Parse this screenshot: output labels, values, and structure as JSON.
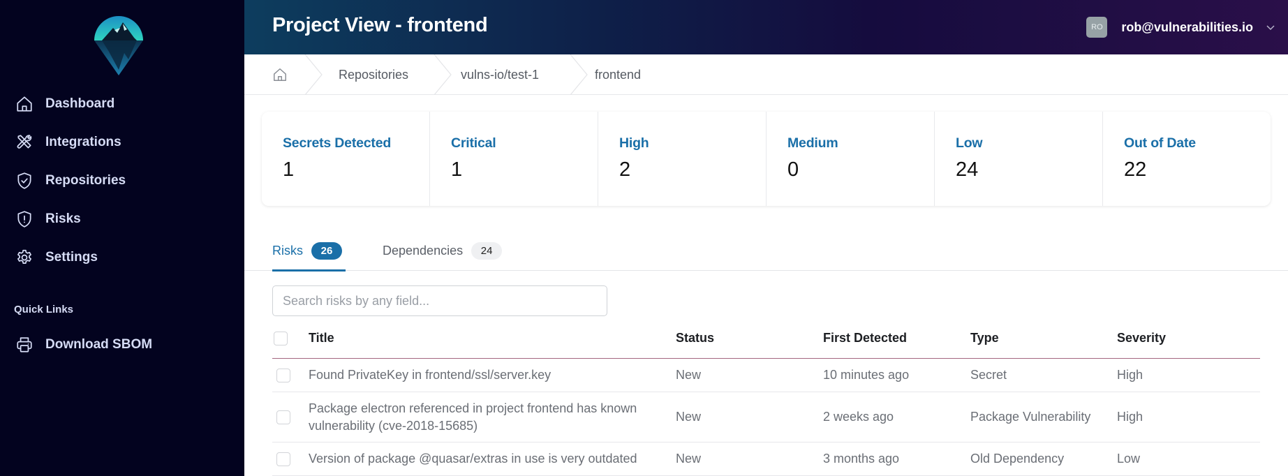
{
  "sidebar": {
    "logo": "vulnerabilities-io-logo",
    "items": [
      {
        "label": "Dashboard",
        "icon": "home-icon"
      },
      {
        "label": "Integrations",
        "icon": "tools-icon"
      },
      {
        "label": "Repositories",
        "icon": "shield-check-icon"
      },
      {
        "label": "Risks",
        "icon": "shield-exclamation-icon"
      },
      {
        "label": "Settings",
        "icon": "gear-icon"
      }
    ],
    "quick_links_title": "Quick Links",
    "quick_links": [
      {
        "label": "Download SBOM",
        "icon": "printer-icon"
      }
    ]
  },
  "header": {
    "title": "Project View - frontend",
    "user": {
      "initials": "RO",
      "email": "rob@vulnerabilities.io"
    }
  },
  "breadcrumb": {
    "home_icon": "home-icon",
    "items": [
      "Repositories",
      "vulns-io/test-1",
      "frontend"
    ]
  },
  "stats": [
    {
      "label": "Secrets Detected",
      "value": "1"
    },
    {
      "label": "Critical",
      "value": "1"
    },
    {
      "label": "High",
      "value": "2"
    },
    {
      "label": "Medium",
      "value": "0"
    },
    {
      "label": "Low",
      "value": "24"
    },
    {
      "label": "Out of Date",
      "value": "22"
    }
  ],
  "tabs": [
    {
      "label": "Risks",
      "count": "26",
      "active": true
    },
    {
      "label": "Dependencies",
      "count": "24",
      "active": false
    }
  ],
  "search": {
    "placeholder": "Search risks by any field...",
    "value": ""
  },
  "table": {
    "columns": [
      "Title",
      "Status",
      "First Detected",
      "Type",
      "Severity"
    ],
    "rows": [
      {
        "title": "Found PrivateKey in frontend/ssl/server.key",
        "status": "New",
        "first_detected": "10 minutes ago",
        "type": "Secret",
        "severity": "High"
      },
      {
        "title_line1": "Package electron referenced in project frontend has known",
        "title_line2": "vulnerability (cve-2018-15685)",
        "status": "New",
        "first_detected": "2 weeks ago",
        "type": "Package Vulnerability",
        "severity": "High"
      },
      {
        "title": "Version of package @quasar/extras in use is very outdated",
        "status": "New",
        "first_detected": "3 months ago",
        "type": "Old Dependency",
        "severity": "Low"
      }
    ]
  },
  "colors": {
    "sidebar_bg": "#03031f",
    "accent": "#1a6fa8",
    "table_header_border": "#a3657f",
    "avatar_bg": "#97a2a6"
  }
}
